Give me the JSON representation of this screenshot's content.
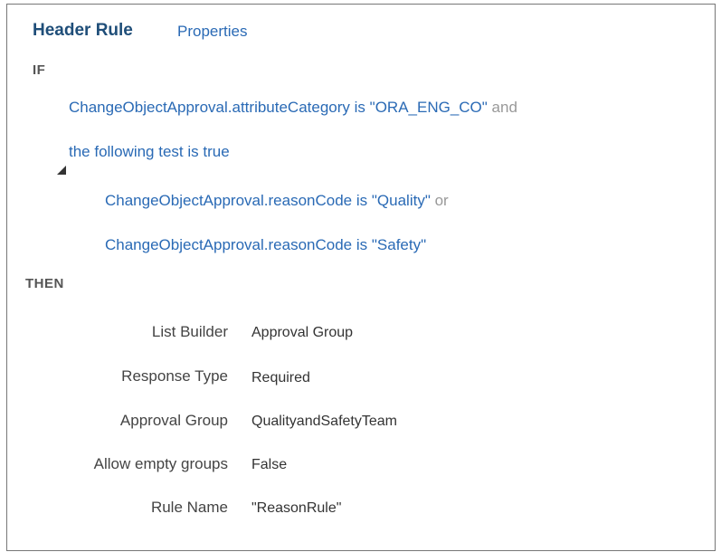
{
  "header": {
    "title": "Header Rule",
    "properties_link": "Properties"
  },
  "rule": {
    "if_keyword": "IF",
    "then_keyword": "THEN",
    "conditions": [
      {
        "attribute": "ChangeObjectApproval.attributeCategory",
        "operator": "is",
        "value": "\"ORA_ENG_CO\"",
        "connector": "and"
      },
      {
        "text": "the following test is true"
      },
      {
        "attribute": "ChangeObjectApproval.reasonCode",
        "operator": "is",
        "value": "\"Quality\"",
        "connector": "or"
      },
      {
        "attribute": "ChangeObjectApproval.reasonCode",
        "operator": "is",
        "value": "\"Safety\""
      }
    ],
    "actions": [
      {
        "label": "List Builder",
        "value": "Approval Group"
      },
      {
        "label": "Response Type",
        "value": "Required"
      },
      {
        "label": "Approval Group",
        "value": "QualityandSafetyTeam"
      },
      {
        "label": "Allow empty groups",
        "value": "False"
      },
      {
        "label": "Rule Name",
        "value": "\"ReasonRule\""
      }
    ]
  },
  "colors": {
    "link_blue": "#2a6ab5",
    "title_blue": "#1f4e79",
    "connector_gray": "#999999"
  },
  "icons": {
    "group_toggle": "expanded-triangle-icon"
  }
}
